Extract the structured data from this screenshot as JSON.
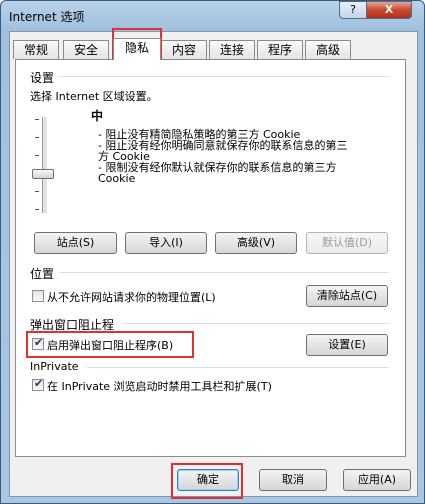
{
  "window": {
    "title": "Internet 选项",
    "help_label": "?",
    "close_label": "X"
  },
  "tabs": [
    {
      "label": "常规"
    },
    {
      "label": "安全"
    },
    {
      "label": "隐私"
    },
    {
      "label": "内容"
    },
    {
      "label": "连接"
    },
    {
      "label": "程序"
    },
    {
      "label": "高级"
    }
  ],
  "settings": {
    "group_label": "设置",
    "instruction": "选择 Internet 区域设置。",
    "level": "中",
    "descriptions": [
      "- 阻止没有精简隐私策略的第三方 Cookie",
      "- 阻止没有经你明确同意就保存你的联系信息的第三方 Cookie",
      "- 限制没有经你默认就保存你的联系信息的第三方 Cookie"
    ],
    "desc_lines": [
      "- 阻止没有精简隐私策略的第三方 Cookie",
      "- 阻止没有经你明确同意就保存你的联系信息的第三",
      "方 Cookie",
      "- 限制没有经你默认就保存你的联系信息的第三方",
      "Cookie"
    ],
    "buttons": {
      "sites": "站点(S)",
      "import": "导入(I)",
      "advanced": "高级(V)",
      "default": "默认值(D)"
    }
  },
  "location": {
    "group_label": "位置",
    "checkbox_label": "从不允许网站请求你的物理位置(L)",
    "checked": false,
    "clear_button": "清除站点(C)"
  },
  "popup": {
    "group_label": "弹出窗口阻止程",
    "checkbox_label": "启用弹出窗口阻止程序(B)",
    "checked": true,
    "settings_button": "设置(E)"
  },
  "inprivate": {
    "group_label": "InPrivate",
    "checkbox_label": "在 InPrivate 浏览启动时禁用工具栏和扩展(T)",
    "checked": true
  },
  "footer": {
    "ok": "确定",
    "cancel": "取消",
    "apply": "应用(A)"
  },
  "colors": {
    "highlight": "#e03030",
    "window_frame": "#a9c7e3"
  }
}
